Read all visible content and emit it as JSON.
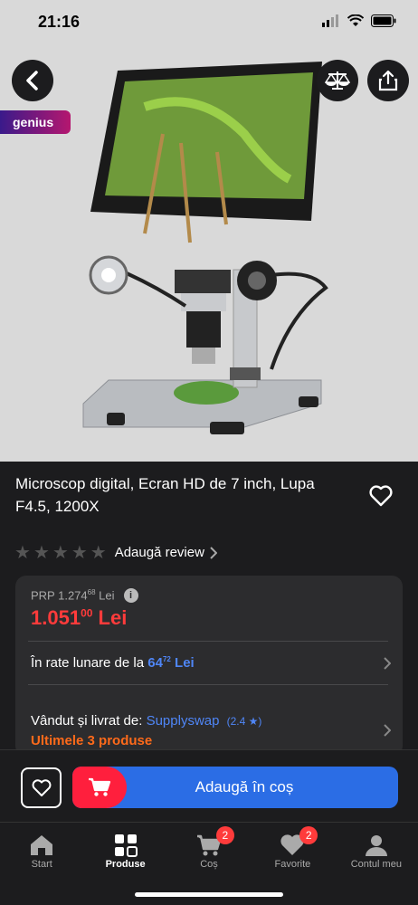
{
  "status": {
    "time": "21:16"
  },
  "badge": {
    "label": "genius"
  },
  "product": {
    "title": "Microscop digital, Ecran HD de 7 inch, Lupa F4.5, 1200X",
    "rating_stars": 0,
    "review_link": "Adaugă review"
  },
  "price": {
    "prp_prefix": "PRP 1.274",
    "prp_sup": "68",
    "prp_suffix": "Lei",
    "current_main": "1.051",
    "current_sup": "00",
    "current_suffix": "Lei"
  },
  "installments": {
    "prefix": "În rate lunare de la",
    "value_main": "64",
    "value_sup": "72",
    "suffix": "Lei"
  },
  "seller": {
    "prefix": "Vândut și livrat de:",
    "name": "Supplyswap",
    "rating": "(2.4 ★)"
  },
  "stock": "Ultimele 3 produse",
  "actions": {
    "add_to_cart": "Adaugă în coș"
  },
  "nav": [
    {
      "label": "Start",
      "icon": "home-icon"
    },
    {
      "label": "Produse",
      "icon": "grid-icon"
    },
    {
      "label": "Coș",
      "icon": "cart-icon",
      "badge": "2"
    },
    {
      "label": "Favorite",
      "icon": "heart-icon",
      "badge": "2"
    },
    {
      "label": "Contul meu",
      "icon": "user-icon"
    }
  ],
  "colors": {
    "accent_blue": "#2b6de5",
    "accent_red": "#ff1f3d",
    "price_red": "#ff3b3b",
    "stock_orange": "#ff6a1a",
    "link_blue": "#4f86f7"
  }
}
